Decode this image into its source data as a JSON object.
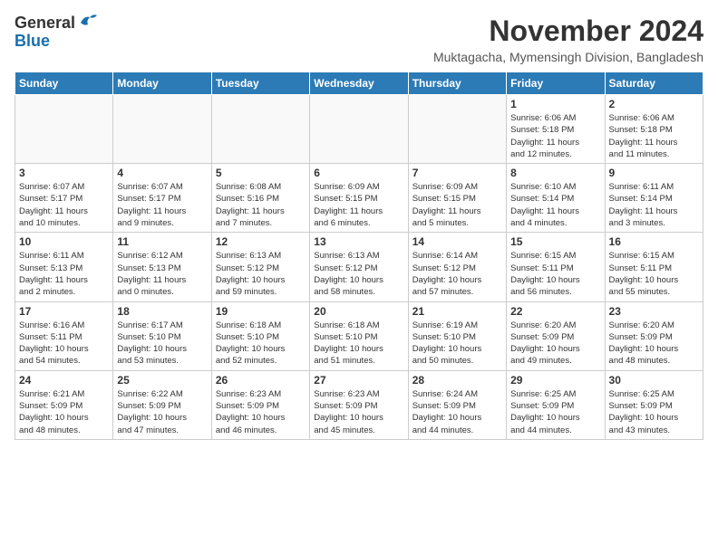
{
  "logo": {
    "general": "General",
    "blue": "Blue"
  },
  "header": {
    "month": "November 2024",
    "location": "Muktagacha, Mymensingh Division, Bangladesh"
  },
  "weekdays": [
    "Sunday",
    "Monday",
    "Tuesday",
    "Wednesday",
    "Thursday",
    "Friday",
    "Saturday"
  ],
  "weeks": [
    [
      {
        "day": "",
        "info": ""
      },
      {
        "day": "",
        "info": ""
      },
      {
        "day": "",
        "info": ""
      },
      {
        "day": "",
        "info": ""
      },
      {
        "day": "",
        "info": ""
      },
      {
        "day": "1",
        "info": "Sunrise: 6:06 AM\nSunset: 5:18 PM\nDaylight: 11 hours\nand 12 minutes."
      },
      {
        "day": "2",
        "info": "Sunrise: 6:06 AM\nSunset: 5:18 PM\nDaylight: 11 hours\nand 11 minutes."
      }
    ],
    [
      {
        "day": "3",
        "info": "Sunrise: 6:07 AM\nSunset: 5:17 PM\nDaylight: 11 hours\nand 10 minutes."
      },
      {
        "day": "4",
        "info": "Sunrise: 6:07 AM\nSunset: 5:17 PM\nDaylight: 11 hours\nand 9 minutes."
      },
      {
        "day": "5",
        "info": "Sunrise: 6:08 AM\nSunset: 5:16 PM\nDaylight: 11 hours\nand 7 minutes."
      },
      {
        "day": "6",
        "info": "Sunrise: 6:09 AM\nSunset: 5:15 PM\nDaylight: 11 hours\nand 6 minutes."
      },
      {
        "day": "7",
        "info": "Sunrise: 6:09 AM\nSunset: 5:15 PM\nDaylight: 11 hours\nand 5 minutes."
      },
      {
        "day": "8",
        "info": "Sunrise: 6:10 AM\nSunset: 5:14 PM\nDaylight: 11 hours\nand 4 minutes."
      },
      {
        "day": "9",
        "info": "Sunrise: 6:11 AM\nSunset: 5:14 PM\nDaylight: 11 hours\nand 3 minutes."
      }
    ],
    [
      {
        "day": "10",
        "info": "Sunrise: 6:11 AM\nSunset: 5:13 PM\nDaylight: 11 hours\nand 2 minutes."
      },
      {
        "day": "11",
        "info": "Sunrise: 6:12 AM\nSunset: 5:13 PM\nDaylight: 11 hours\nand 0 minutes."
      },
      {
        "day": "12",
        "info": "Sunrise: 6:13 AM\nSunset: 5:12 PM\nDaylight: 10 hours\nand 59 minutes."
      },
      {
        "day": "13",
        "info": "Sunrise: 6:13 AM\nSunset: 5:12 PM\nDaylight: 10 hours\nand 58 minutes."
      },
      {
        "day": "14",
        "info": "Sunrise: 6:14 AM\nSunset: 5:12 PM\nDaylight: 10 hours\nand 57 minutes."
      },
      {
        "day": "15",
        "info": "Sunrise: 6:15 AM\nSunset: 5:11 PM\nDaylight: 10 hours\nand 56 minutes."
      },
      {
        "day": "16",
        "info": "Sunrise: 6:15 AM\nSunset: 5:11 PM\nDaylight: 10 hours\nand 55 minutes."
      }
    ],
    [
      {
        "day": "17",
        "info": "Sunrise: 6:16 AM\nSunset: 5:11 PM\nDaylight: 10 hours\nand 54 minutes."
      },
      {
        "day": "18",
        "info": "Sunrise: 6:17 AM\nSunset: 5:10 PM\nDaylight: 10 hours\nand 53 minutes."
      },
      {
        "day": "19",
        "info": "Sunrise: 6:18 AM\nSunset: 5:10 PM\nDaylight: 10 hours\nand 52 minutes."
      },
      {
        "day": "20",
        "info": "Sunrise: 6:18 AM\nSunset: 5:10 PM\nDaylight: 10 hours\nand 51 minutes."
      },
      {
        "day": "21",
        "info": "Sunrise: 6:19 AM\nSunset: 5:10 PM\nDaylight: 10 hours\nand 50 minutes."
      },
      {
        "day": "22",
        "info": "Sunrise: 6:20 AM\nSunset: 5:09 PM\nDaylight: 10 hours\nand 49 minutes."
      },
      {
        "day": "23",
        "info": "Sunrise: 6:20 AM\nSunset: 5:09 PM\nDaylight: 10 hours\nand 48 minutes."
      }
    ],
    [
      {
        "day": "24",
        "info": "Sunrise: 6:21 AM\nSunset: 5:09 PM\nDaylight: 10 hours\nand 48 minutes."
      },
      {
        "day": "25",
        "info": "Sunrise: 6:22 AM\nSunset: 5:09 PM\nDaylight: 10 hours\nand 47 minutes."
      },
      {
        "day": "26",
        "info": "Sunrise: 6:23 AM\nSunset: 5:09 PM\nDaylight: 10 hours\nand 46 minutes."
      },
      {
        "day": "27",
        "info": "Sunrise: 6:23 AM\nSunset: 5:09 PM\nDaylight: 10 hours\nand 45 minutes."
      },
      {
        "day": "28",
        "info": "Sunrise: 6:24 AM\nSunset: 5:09 PM\nDaylight: 10 hours\nand 44 minutes."
      },
      {
        "day": "29",
        "info": "Sunrise: 6:25 AM\nSunset: 5:09 PM\nDaylight: 10 hours\nand 44 minutes."
      },
      {
        "day": "30",
        "info": "Sunrise: 6:25 AM\nSunset: 5:09 PM\nDaylight: 10 hours\nand 43 minutes."
      }
    ]
  ]
}
